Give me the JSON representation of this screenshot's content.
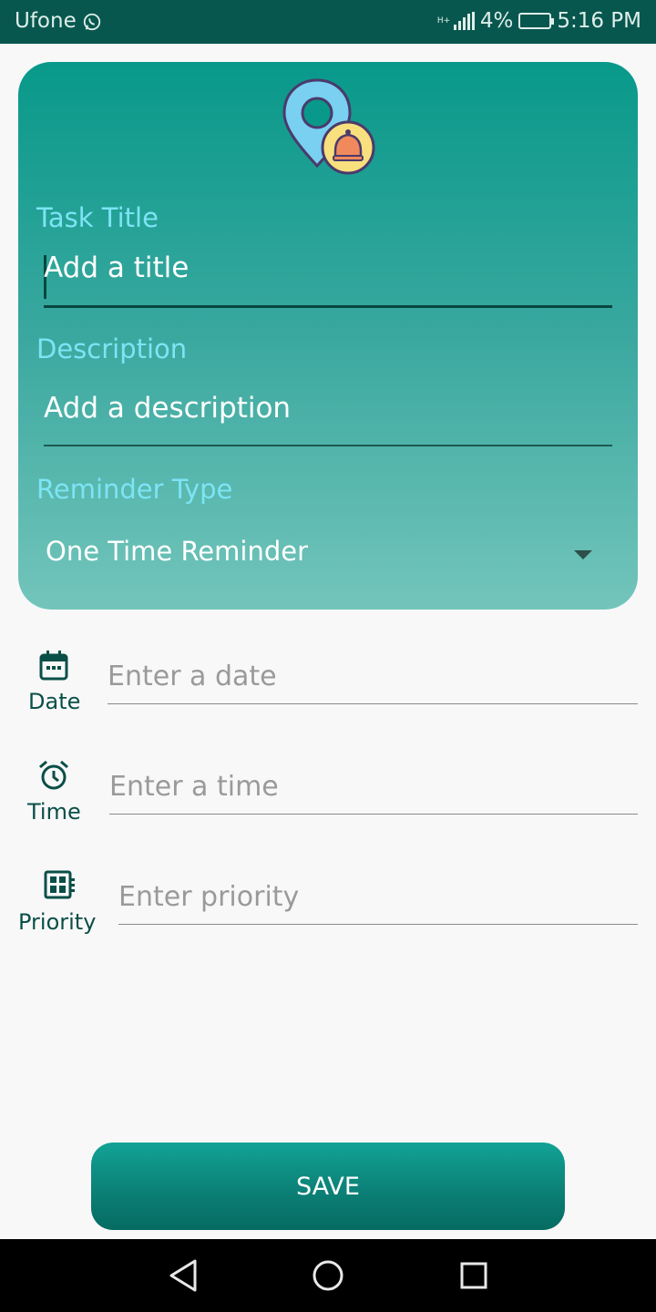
{
  "status_bar": {
    "carrier": "Ufone",
    "network": "H+",
    "battery": "4%",
    "time": "5:16 PM"
  },
  "form": {
    "title_label": "Task Title",
    "title_value": "Add a title",
    "description_label": "Description",
    "description_value": "Add a description",
    "reminder_label": "Reminder Type",
    "reminder_value": "One Time Reminder"
  },
  "schedule": {
    "date_label": "Date",
    "date_placeholder": "Enter a date",
    "time_label": "Time",
    "time_placeholder": "Enter a time",
    "priority_label": "Priority",
    "priority_placeholder": "Enter priority"
  },
  "actions": {
    "save_label": "SAVE"
  },
  "icons": {
    "logo": "location-reminder-icon",
    "date": "calendar-icon",
    "time": "alarm-clock-icon",
    "priority": "priority-grid-icon"
  },
  "colors": {
    "status_bar": "#07574f",
    "card_top": "#08998a",
    "card_bottom": "#73c5bb",
    "label_accent": "#7ce4f4",
    "icon_dark": "#0a4f47",
    "save_button": "#0b7e74"
  }
}
